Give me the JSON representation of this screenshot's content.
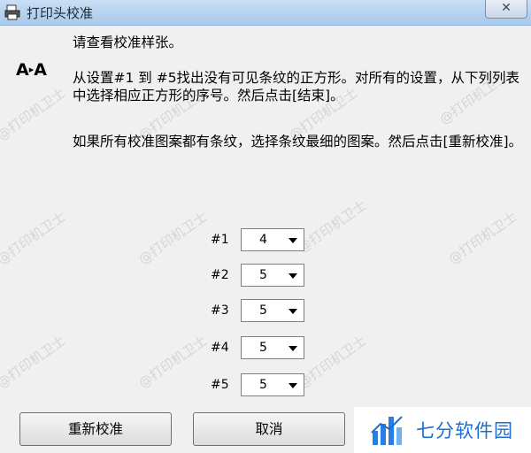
{
  "window": {
    "title": "打印头校准",
    "close_label": "✕"
  },
  "instructions": [
    "请查看校准样张。",
    "从设置#1 到 #5找出没有可见条纹的正方形。对所有的设置，从下列列表中选择相应正方形的序号。然后点击[结束]。",
    "如果所有校准图案都有条纹，选择条纹最细的图案。然后点击[重新校准]。"
  ],
  "icon_text": {
    "left": "A",
    "arrow": "▸",
    "right": "A"
  },
  "settings": [
    {
      "label": "#1",
      "value": "4"
    },
    {
      "label": "#2",
      "value": "5"
    },
    {
      "label": "#3",
      "value": "5"
    },
    {
      "label": "#4",
      "value": "5"
    },
    {
      "label": "#5",
      "value": "5"
    }
  ],
  "buttons": {
    "recalibrate": "重新校准",
    "cancel": "取消"
  },
  "watermark": "@打印机卫士",
  "brand": {
    "name": "七分软件园",
    "color": "#1a6fd0"
  }
}
